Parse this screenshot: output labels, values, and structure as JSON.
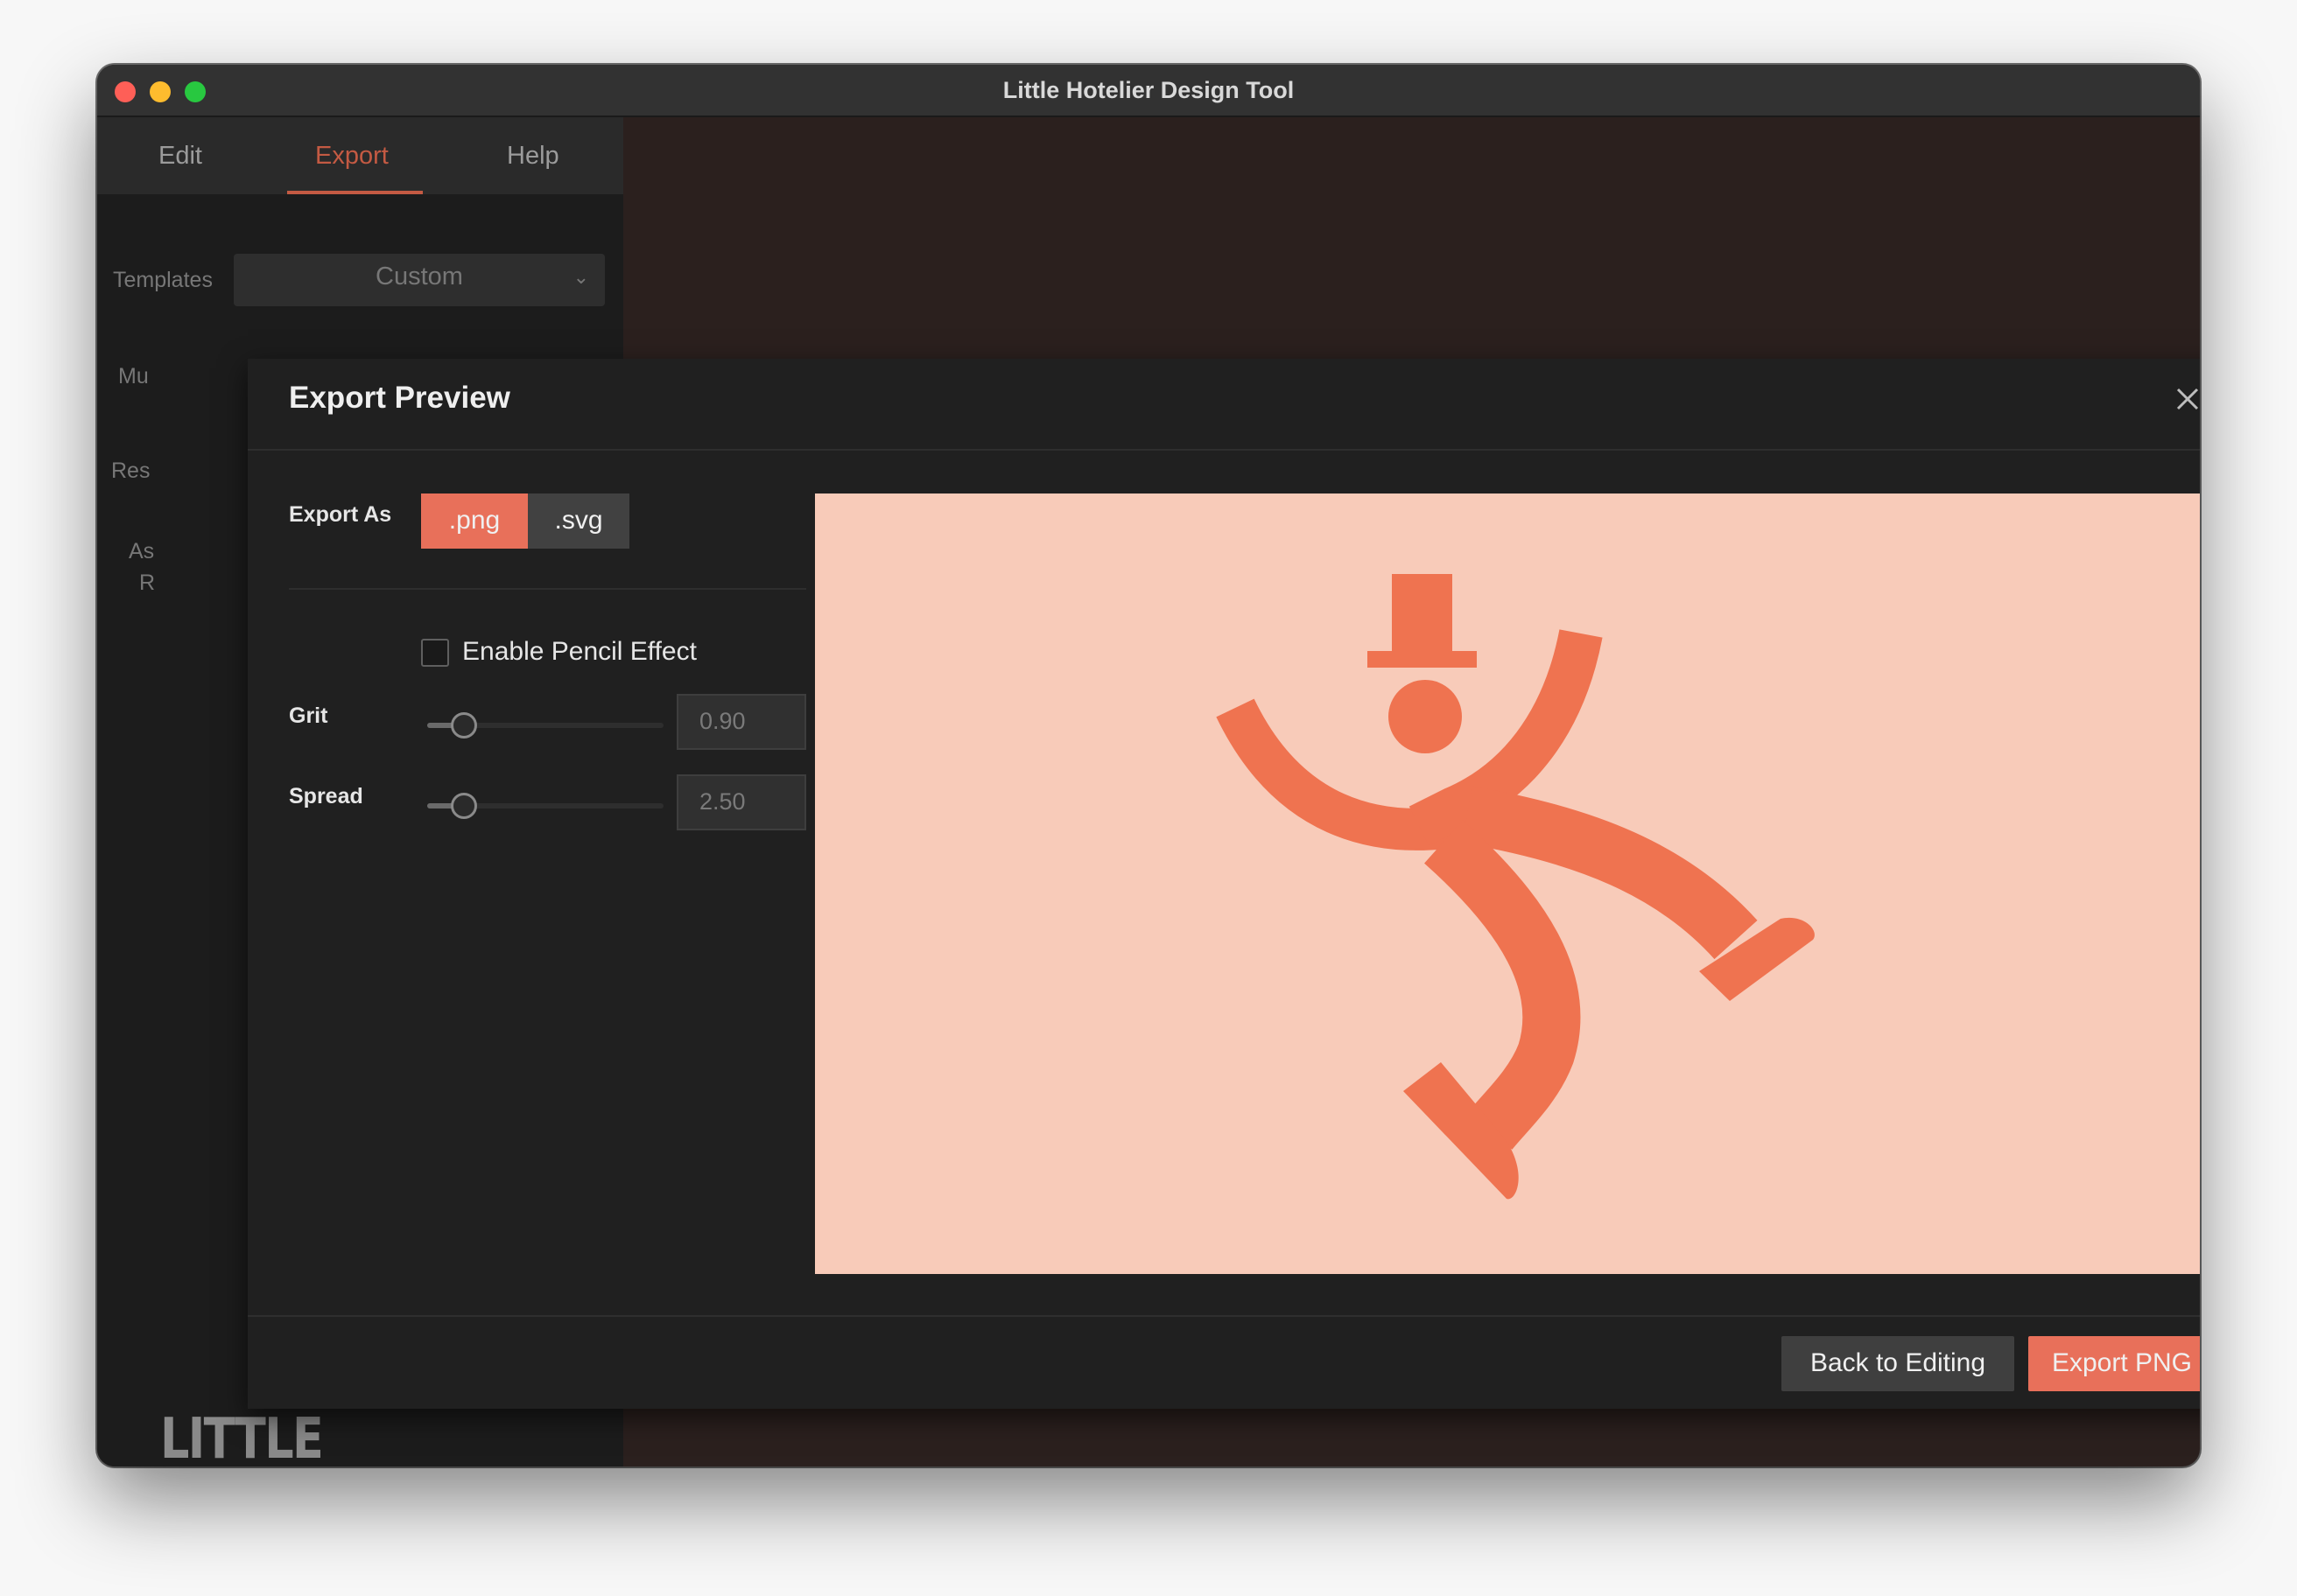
{
  "window": {
    "title": "Little Hotelier Design Tool"
  },
  "sidebar": {
    "tabs": [
      {
        "label": "Edit"
      },
      {
        "label": "Export",
        "active": true
      },
      {
        "label": "Help"
      }
    ],
    "templates_label": "Templates",
    "templates_value": "Custom",
    "partial_labels": [
      "Mu",
      "Res",
      "As",
      "R"
    ],
    "brand": "LITTLE HOTELIER."
  },
  "modal": {
    "title": "Export Preview",
    "export_as_label": "Export As",
    "formats": [
      {
        "label": ".png",
        "selected": true
      },
      {
        "label": ".svg",
        "selected": false
      }
    ],
    "pencil_effect": {
      "label": "Enable Pencil Effect",
      "checked": false
    },
    "grit": {
      "label": "Grit",
      "value": "0.90",
      "level": 0.1
    },
    "spread": {
      "label": "Spread",
      "value": "2.50",
      "level": 0.1
    },
    "back_button": "Back to Editing",
    "export_button": "Export PNG"
  },
  "colors": {
    "accent": "#e8705a",
    "preview_background": "#f8cbb9",
    "logo": "#ef7350",
    "window_bg": "#2b201e"
  },
  "icons": [
    "close-icon",
    "chevron-down-icon",
    "checkbox-icon",
    "hotelier-logo-figure"
  ]
}
